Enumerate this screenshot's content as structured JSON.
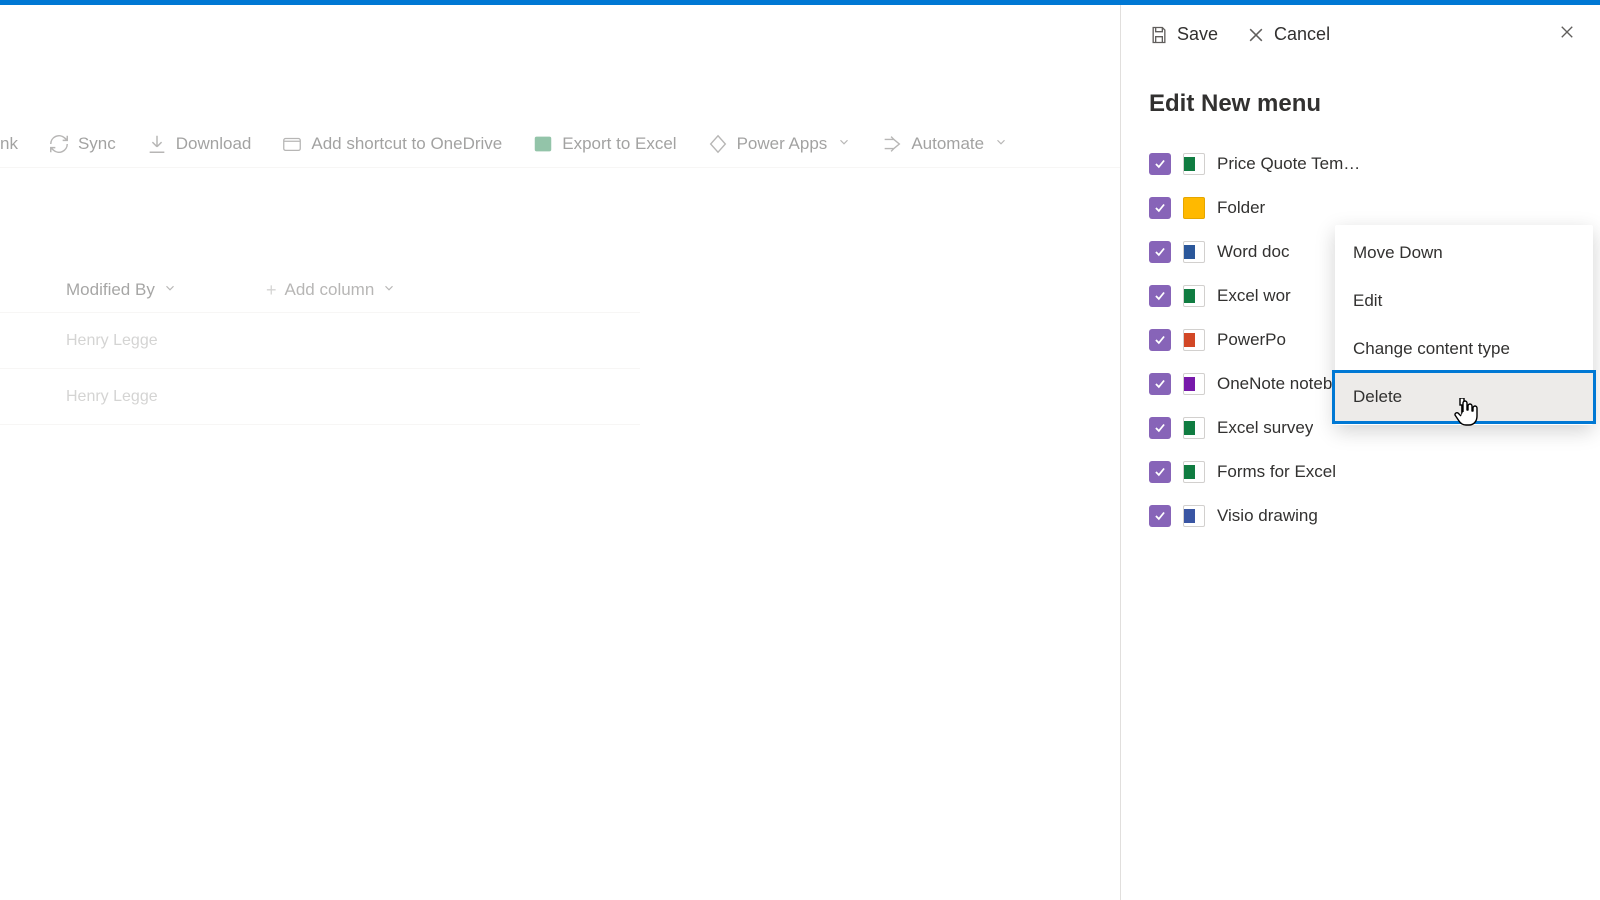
{
  "toolbar": {
    "link_fragment": "nk",
    "sync": "Sync",
    "download": "Download",
    "add_shortcut": "Add shortcut to OneDrive",
    "export_excel": "Export to Excel",
    "power_apps": "Power Apps",
    "automate": "Automate"
  },
  "columns": {
    "modified_by": "Modified By",
    "add_column": "Add column"
  },
  "rows": [
    {
      "modified_by": "Henry Legge"
    },
    {
      "modified_by": "Henry Legge"
    }
  ],
  "panel": {
    "save": "Save",
    "cancel": "Cancel",
    "title": "Edit New menu",
    "items": [
      {
        "label": "Price Quote Templa...",
        "icon": "excel"
      },
      {
        "label": "Folder",
        "icon": "folder"
      },
      {
        "label": "Word doc",
        "icon": "word"
      },
      {
        "label": "Excel wor",
        "icon": "excel"
      },
      {
        "label": "PowerPo",
        "icon": "ppt"
      },
      {
        "label": "OneNote notebook",
        "icon": "onenote"
      },
      {
        "label": "Excel survey",
        "icon": "excel"
      },
      {
        "label": "Forms for Excel",
        "icon": "excel"
      },
      {
        "label": "Visio drawing",
        "icon": "visio"
      }
    ]
  },
  "context_menu": {
    "items": [
      {
        "label": "Move Down",
        "highlight": false
      },
      {
        "label": "Edit",
        "highlight": false
      },
      {
        "label": "Change content type",
        "highlight": false
      },
      {
        "label": "Delete",
        "highlight": true
      }
    ]
  }
}
